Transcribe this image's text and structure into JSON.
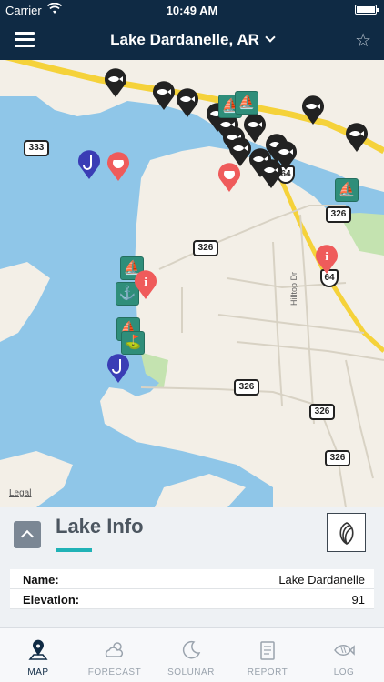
{
  "status_bar": {
    "carrier": "Carrier",
    "time": "10:49 AM"
  },
  "nav": {
    "title": "Lake Dardanelle, AR"
  },
  "map": {
    "legal": "Legal",
    "road_labels": {
      "hilltop": "Hilltop Dr"
    },
    "highway_shields": {
      "r333": "333",
      "r326a": "326",
      "r326b": "326",
      "r326c": "326",
      "r326d": "326",
      "r326e": "326",
      "us64a": "64",
      "us64b": "64"
    }
  },
  "info_panel": {
    "title": "Lake Info",
    "rows": [
      {
        "key": "Name:",
        "value": "Lake Dardanelle"
      },
      {
        "key": "Elevation:",
        "value": "91"
      }
    ]
  },
  "tabs": [
    {
      "label": "MAP",
      "icon": "map-pin-icon",
      "active": true
    },
    {
      "label": "FORECAST",
      "icon": "cloud-sun-icon",
      "active": false
    },
    {
      "label": "SOLUNAR",
      "icon": "moon-icon",
      "active": false
    },
    {
      "label": "REPORT",
      "icon": "clipboard-icon",
      "active": false
    },
    {
      "label": "LOG",
      "icon": "fish-icon",
      "active": false
    }
  ],
  "colors": {
    "navy": "#0f2a44",
    "water": "#8fc6e8",
    "park": "#c4e3b0",
    "teal_accent": "#20b2b6",
    "fishing_pin": "#3a3db5",
    "info_pin": "#ef5b5b",
    "ramp_marker": "#2f8e7a"
  }
}
